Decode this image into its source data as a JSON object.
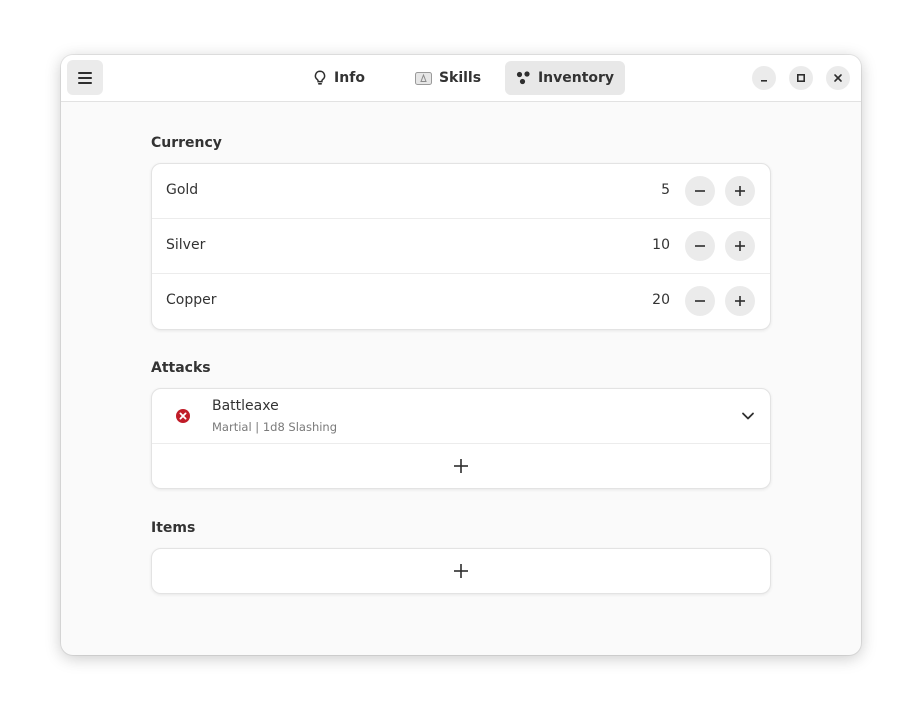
{
  "header": {
    "tabs": [
      {
        "label": "Info",
        "icon": "lightbulb-icon"
      },
      {
        "label": "Skills",
        "icon": "skills-card-icon"
      },
      {
        "label": "Inventory",
        "icon": "inventory-icon",
        "active": true
      }
    ]
  },
  "currency": {
    "title": "Currency",
    "rows": [
      {
        "label": "Gold",
        "value": "5"
      },
      {
        "label": "Silver",
        "value": "10"
      },
      {
        "label": "Copper",
        "value": "20"
      }
    ]
  },
  "attacks": {
    "title": "Attacks",
    "items": [
      {
        "name": "Battleaxe",
        "detail": "Martial | 1d8 Slashing",
        "status_color": "#c01c28"
      }
    ]
  },
  "items": {
    "title": "Items"
  },
  "colors": {
    "accent_bg": "#e8e8e8",
    "danger": "#c01c28"
  }
}
